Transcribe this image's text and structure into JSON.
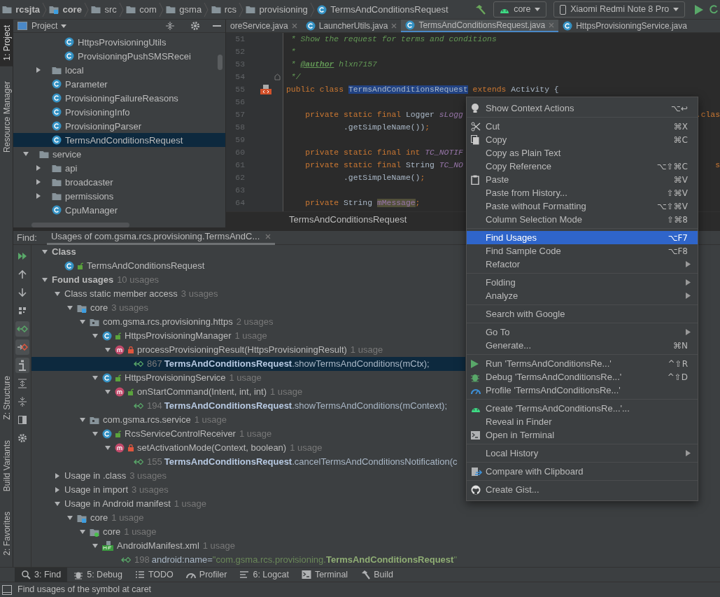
{
  "breadcrumbs": [
    {
      "kind": "project",
      "label": "rcsjta"
    },
    {
      "kind": "module",
      "label": "core"
    },
    {
      "kind": "folder",
      "label": "src"
    },
    {
      "kind": "package",
      "label": "com"
    },
    {
      "kind": "package",
      "label": "gsma"
    },
    {
      "kind": "package",
      "label": "rcs"
    },
    {
      "kind": "package",
      "label": "provisioning"
    },
    {
      "kind": "class",
      "label": "TermsAndConditionsRequest"
    }
  ],
  "run_config": {
    "label": "core"
  },
  "device": {
    "label": "Xiaomi Redmi Note 8 Pro"
  },
  "left_stripe": {
    "top": [
      {
        "label": "1: Project",
        "selected": true
      },
      {
        "label": "Resource Manager",
        "selected": false
      }
    ],
    "bottom": [
      {
        "label": "Z: Structure",
        "selected": false
      },
      {
        "label": "Build Variants",
        "selected": false
      },
      {
        "label": "2: Favorites",
        "selected": false
      }
    ]
  },
  "project_panel": {
    "title": "Project",
    "tree": [
      {
        "children": [
          {
            "kind": "class",
            "label": "HttpsProvisioningUtils",
            "selected": false
          },
          {
            "kind": "class",
            "label": "ProvisioningPushSMSRecei",
            "selected": false
          }
        ]
      },
      {
        "kind": "folder",
        "label": "local",
        "expanded": false,
        "selected": false
      },
      {
        "kind": "class",
        "label": "Parameter",
        "selected": false
      },
      {
        "kind": "class",
        "label": "ProvisioningFailureReasons",
        "selected": false
      },
      {
        "kind": "class",
        "label": "ProvisioningInfo",
        "selected": false
      },
      {
        "kind": "class",
        "label": "ProvisioningParser",
        "selected": false
      },
      {
        "kind": "class",
        "label": "TermsAndConditionsRequest",
        "selected": true
      }
    ]
  },
  "project_panel_lower": [
    {
      "kind": "folder",
      "label": "service",
      "expanded": true,
      "selected": false,
      "children": [
        {
          "kind": "folder",
          "label": "api",
          "expanded": false,
          "selected": false
        },
        {
          "kind": "folder",
          "label": "broadcaster",
          "expanded": false,
          "selected": false
        },
        {
          "kind": "folder",
          "label": "permissions",
          "expanded": false,
          "selected": false
        },
        {
          "kind": "class",
          "label": "CpuManager",
          "selected": false
        }
      ]
    }
  ],
  "editor_tabs": [
    {
      "label": "oreService.java",
      "selected": false,
      "icon": false,
      "closable": true
    },
    {
      "label": "LauncherUtils.java",
      "selected": false,
      "icon": true,
      "closable": true
    },
    {
      "label": "TermsAndConditionsRequest.java",
      "selected": true,
      "icon": true,
      "closable": true
    },
    {
      "label": "HttpsProvisioningService.java",
      "selected": false,
      "icon": true,
      "closable": false
    }
  ],
  "code_lines": [
    {
      "number": "51",
      "segments": [
        {
          "kind": "doc",
          "text": " * Show the request for terms and conditions"
        }
      ]
    },
    {
      "number": "52",
      "segments": [
        {
          "kind": "doc",
          "text": " *"
        }
      ]
    },
    {
      "number": "53",
      "segments": [
        {
          "kind": "doc",
          "text": " * "
        },
        {
          "kind": "doctag",
          "text": "@author"
        },
        {
          "kind": "docval",
          "text": " hlxn7157"
        }
      ]
    },
    {
      "number": "54",
      "fold": true,
      "segments": [
        {
          "kind": "doc",
          "text": " */"
        }
      ]
    },
    {
      "number": "55",
      "marker": true,
      "segments": [
        {
          "kind": "keyword",
          "text": "public class "
        },
        {
          "kind": "selection",
          "text": "TermsAndConditionsRequest"
        },
        {
          "kind": "keyword",
          "text": " extends "
        },
        {
          "kind": "plain",
          "text": "Activity {"
        }
      ]
    },
    {
      "number": "56"
    },
    {
      "number": "57",
      "segments": [
        {
          "kind": "keyword",
          "text": "    private static final "
        },
        {
          "kind": "plain",
          "text": "Logger "
        },
        {
          "kind": "static",
          "text": "sLogg"
        }
      ],
      "tail": ".clas"
    },
    {
      "number": "58",
      "segments": [
        {
          "kind": "plain",
          "text": "            .getSimpleName())"
        },
        {
          "kind": "keyword",
          "text": ";"
        }
      ]
    },
    {
      "number": "59"
    },
    {
      "number": "60",
      "segments": [
        {
          "kind": "keyword",
          "text": "    private static final int "
        },
        {
          "kind": "static",
          "text": "TC_NOTIF"
        }
      ]
    },
    {
      "number": "61",
      "segments": [
        {
          "kind": "keyword",
          "text": "    private static final "
        },
        {
          "kind": "plain",
          "text": "String "
        },
        {
          "kind": "static",
          "text": "TC_NO"
        }
      ],
      "tail": "s"
    },
    {
      "number": "62",
      "segments": [
        {
          "kind": "plain",
          "text": "            .getSimpleName()"
        },
        {
          "kind": "keyword",
          "text": ";"
        }
      ]
    },
    {
      "number": "63"
    },
    {
      "number": "64",
      "segments": [
        {
          "kind": "keyword",
          "text": "    private "
        },
        {
          "kind": "plain",
          "text": "String "
        },
        {
          "kind": "field_highlight",
          "text": "mMessage"
        },
        {
          "kind": "keyword",
          "text": ";"
        }
      ]
    }
  ],
  "editor_breadcrumb": "TermsAndConditionsRequest",
  "find_panel": {
    "label": "Find:",
    "tab": {
      "label": "Usages of com.gsma.rcs.provisioning.TermsAndC...",
      "selected": true
    },
    "toolbar": [
      {
        "kind": "rerun",
        "pressed": false
      },
      {
        "kind": "up",
        "pressed": false
      },
      {
        "kind": "down",
        "pressed": false
      },
      {
        "kind": "group",
        "pressed": false
      },
      {
        "kind": "read",
        "pressed": true
      },
      {
        "kind": "write",
        "pressed": true
      },
      {
        "kind": "info",
        "pressed": true
      },
      {
        "kind": "expand",
        "pressed": false
      },
      {
        "kind": "collapse",
        "pressed": false
      },
      {
        "kind": "preview",
        "pressed": false
      },
      {
        "kind": "settings",
        "pressed": false
      }
    ],
    "tree": [
      {
        "kind": "root",
        "label": "Class",
        "expanded": true,
        "selected": false,
        "children": [
          {
            "kind": "class",
            "private": false,
            "label": "TermsAndConditionsRequest",
            "selected": false
          }
        ]
      },
      {
        "kind": "root",
        "label": "Found usages",
        "count": "10 usages",
        "expanded": true,
        "selected": false,
        "children": [
          {
            "kind": "group",
            "label": "Class static member access",
            "count": "3 usages",
            "expanded": true,
            "selected": false,
            "children": [
              {
                "kind": "module",
                "label": "core",
                "count": "3 usages",
                "expanded": true,
                "selected": false,
                "children": [
                  {
                    "kind": "package",
                    "label": "com.gsma.rcs.provisioning.https",
                    "count": "2 usages",
                    "expanded": true,
                    "selected": false,
                    "children": [
                      {
                        "kind": "class",
                        "private": false,
                        "label": "HttpsProvisioningManager",
                        "count": "1 usage",
                        "expanded": true,
                        "selected": false,
                        "children": [
                          {
                            "kind": "method",
                            "private": true,
                            "label": "processProvisioningResult(HttpsProvisioningResult)",
                            "count": "1 usage",
                            "expanded": true,
                            "selected": false,
                            "children": [
                              {
                                "kind": "usage",
                                "line_no": "867",
                                "text": "**TermsAndConditionsRequest**.showTermsAndConditions(mCtx);",
                                "selected": true
                              }
                            ]
                          }
                        ]
                      },
                      {
                        "kind": "class",
                        "private": false,
                        "label": "HttpsProvisioningService",
                        "count": "1 usage",
                        "expanded": true,
                        "selected": false,
                        "children": [
                          {
                            "kind": "method",
                            "private": false,
                            "label": "onStartCommand(Intent, int, int)",
                            "count": "1 usage",
                            "expanded": true,
                            "selected": false,
                            "children": [
                              {
                                "kind": "usage",
                                "line_no": "194",
                                "text": "**TermsAndConditionsRequest**.showTermsAndConditions(mContext);",
                                "selected": false
                              }
                            ]
                          }
                        ]
                      }
                    ]
                  },
                  {
                    "kind": "package",
                    "label": "com.gsma.rcs.service",
                    "count": "1 usage",
                    "expanded": true,
                    "selected": false,
                    "children": [
                      {
                        "kind": "class",
                        "private": false,
                        "label": "RcsServiceControlReceiver",
                        "count": "1 usage",
                        "expanded": true,
                        "selected": false,
                        "children": [
                          {
                            "kind": "method",
                            "private": true,
                            "label": "setActivationMode(Context, boolean)",
                            "count": "1 usage",
                            "expanded": true,
                            "selected": false,
                            "children": [
                              {
                                "kind": "usage",
                                "line_no": "155",
                                "text": "**TermsAndConditionsRequest**.cancelTermsAndConditionsNotification(c",
                                "selected": false
                              }
                            ]
                          }
                        ]
                      }
                    ]
                  }
                ]
              }
            ]
          },
          {
            "kind": "group",
            "label": "Usage in .class",
            "count": "3 usages",
            "expanded": false,
            "selected": false
          },
          {
            "kind": "group",
            "label": "Usage in import",
            "count": "3 usages",
            "expanded": false,
            "selected": false
          },
          {
            "kind": "group",
            "label": "Usage in Android manifest",
            "count": "1 usage",
            "expanded": true,
            "selected": false,
            "children": [
              {
                "kind": "module",
                "label": "core",
                "count": "1 usage",
                "expanded": true,
                "selected": false,
                "children": [
                  {
                    "kind": "source",
                    "label": "core",
                    "count": "1 usage",
                    "expanded": true,
                    "selected": false,
                    "children": [
                      {
                        "kind": "manifest",
                        "label": "AndroidManifest.xml",
                        "count": "1 usage",
                        "expanded": true,
                        "selected": false,
                        "children": [
                          {
                            "kind": "usage",
                            "line_no": "198",
                            "text": "android:name=",
                            "string": "\"com.gsma.rcs.provisioning.**TermsAndConditionsRequest**\"",
                            "selected": false
                          }
                        ]
                      }
                    ]
                  }
                ]
              }
            ]
          }
        ]
      }
    ]
  },
  "context_menu": [
    [
      {
        "kind": "bulb",
        "label": "Show Context Actions",
        "shortcut": "⌥↩",
        "selected": false
      }
    ],
    [
      {
        "kind": "scissors",
        "label": "Cut",
        "shortcut": "⌘X",
        "selected": false
      },
      {
        "kind": "copy",
        "label": "Copy",
        "shortcut": "⌘C",
        "selected": false
      },
      {
        "label": "Copy as Plain Text",
        "selected": false
      },
      {
        "label": "Copy Reference",
        "shortcut": "⌥⇧⌘C",
        "selected": false
      },
      {
        "kind": "paste",
        "label": "Paste",
        "shortcut": "⌘V",
        "selected": false
      },
      {
        "label": "Paste from History...",
        "shortcut": "⇧⌘V",
        "selected": false
      },
      {
        "label": "Paste without Formatting",
        "shortcut": "⌥⇧⌘V",
        "selected": false
      },
      {
        "label": "Column Selection Mode",
        "shortcut": "⇧⌘8",
        "selected": false
      }
    ],
    [
      {
        "label": "Find Usages",
        "shortcut": "⌥F7",
        "selected": true
      },
      {
        "label": "Find Sample Code",
        "shortcut": "⌥F8",
        "selected": false
      },
      {
        "label": "Refactor",
        "submenu": true,
        "selected": false
      }
    ],
    [
      {
        "label": "Folding",
        "submenu": true,
        "selected": false
      },
      {
        "label": "Analyze",
        "submenu": true,
        "selected": false
      }
    ],
    [
      {
        "label": "Search with Google",
        "selected": false
      }
    ],
    [
      {
        "label": "Go To",
        "submenu": true,
        "selected": false
      },
      {
        "label": "Generate...",
        "shortcut": "⌘N",
        "selected": false
      }
    ],
    [
      {
        "kind": "run",
        "label": "Run 'TermsAndConditionsRe...'",
        "shortcut": "^⇧R",
        "selected": false
      },
      {
        "kind": "debug",
        "label": "Debug 'TermsAndConditionsRe...'",
        "shortcut": "^⇧D",
        "selected": false
      },
      {
        "kind": "profile",
        "label": "Profile 'TermsAndConditionsRe...'",
        "selected": false
      }
    ],
    [
      {
        "kind": "android",
        "label": "Create 'TermsAndConditionsRe...'...",
        "selected": false
      },
      {
        "label": "Reveal in Finder",
        "selected": false
      },
      {
        "kind": "terminal",
        "label": "Open in Terminal",
        "selected": false
      }
    ],
    [
      {
        "label": "Local History",
        "submenu": true,
        "selected": false
      }
    ],
    [
      {
        "kind": "compare",
        "label": "Compare with Clipboard",
        "selected": false
      }
    ],
    [
      {
        "kind": "github",
        "label": "Create Gist...",
        "selected": false
      }
    ]
  ],
  "tool_tabs": [
    {
      "kind": "search",
      "label": "3: Find",
      "selected": true
    },
    {
      "kind": "bug",
      "label": "5: Debug",
      "selected": false
    },
    {
      "kind": "list",
      "label": "TODO",
      "selected": false
    },
    {
      "kind": "gauge",
      "label": "Profiler",
      "selected": false
    },
    {
      "kind": "lines",
      "label": "6: Logcat",
      "selected": false
    },
    {
      "kind": "terminal",
      "label": "Terminal",
      "selected": false
    },
    {
      "kind": "hammer",
      "label": "Build",
      "selected": false
    }
  ],
  "status_bar": {
    "text": "Find usages of the symbol at caret"
  }
}
